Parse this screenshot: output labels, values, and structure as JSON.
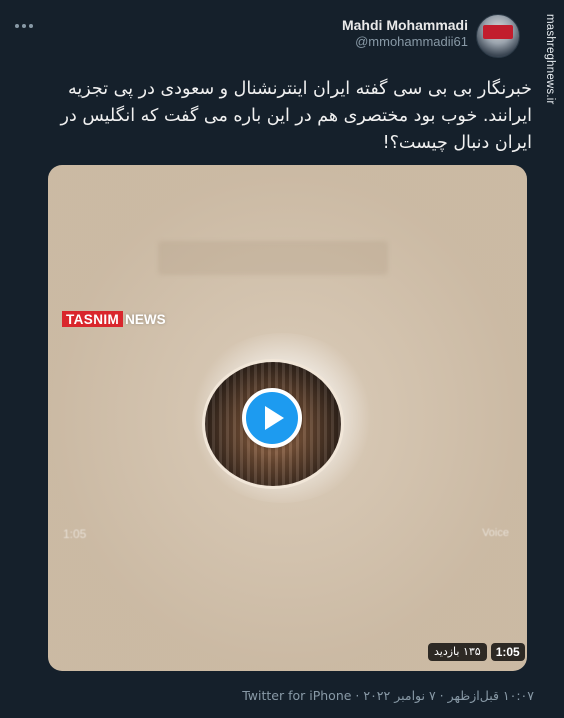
{
  "author": {
    "display_name": "Mahdi Mohammadi",
    "handle": "@mmohammadii61"
  },
  "watermark": "mashreghnews.ir",
  "tweet": {
    "text": "خبرنگار بی بی سی گفته ایران اینترنشنال و سعودی در پی تجزیه ایرانند. خوب بود مختصری هم در این باره می گفت که انگلیس در ایران دنبال چیست؟!"
  },
  "media": {
    "logo_primary": "TASNIM",
    "logo_secondary": "NEWS",
    "ghost_left": "1:05",
    "ghost_right": "Voice",
    "views": "۱۳۵ بازدید",
    "duration": "1:05"
  },
  "footer": {
    "timestamp": "۱۰:۰۷ قبل‌ازظهر · ۷ نوامبر ۲۰۲۲ · Twitter for iPhone"
  },
  "icons": {
    "more": "more-icon",
    "play": "play-icon"
  },
  "colors": {
    "background": "#15202b",
    "accent": "#1d9bf0",
    "media_bg": "#d3c1aa",
    "brand_red": "#d9262c"
  }
}
